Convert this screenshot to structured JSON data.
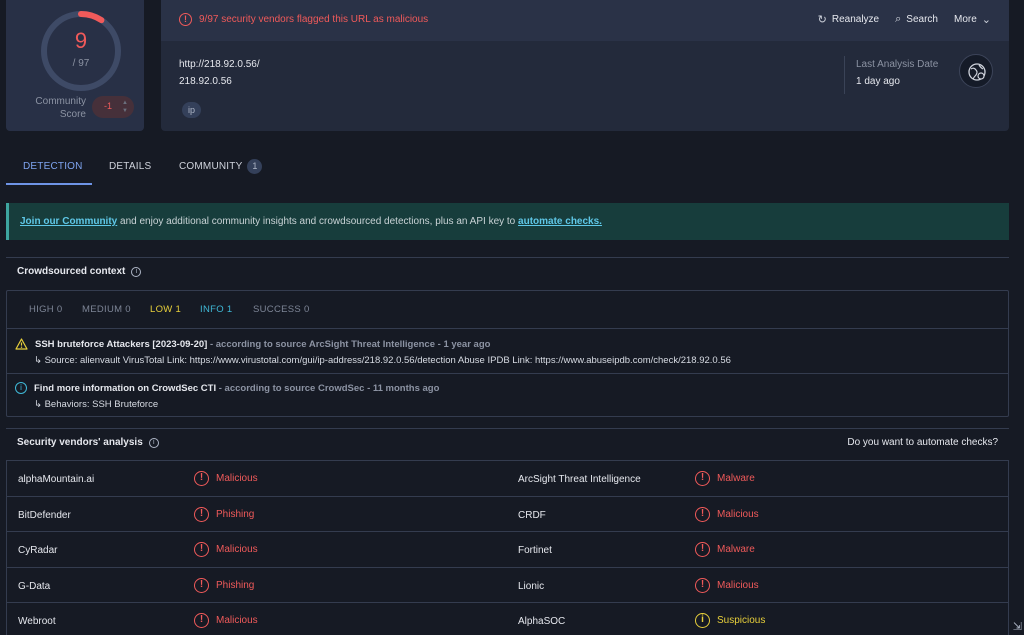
{
  "score": {
    "detections": "9",
    "total": "/ 97",
    "ratio": 0.093,
    "community_label_1": "Community",
    "community_label_2": "Score",
    "community_value": "-1"
  },
  "header": {
    "alert_text": "9/97 security vendors flagged this URL as malicious",
    "reanalyze_label": "Reanalyze",
    "search_label": "Search",
    "more_label": "More",
    "url": "http://218.92.0.56/",
    "ip": "218.92.0.56",
    "tag": "ip",
    "last_analysis_label": "Last Analysis Date",
    "last_analysis_value": "1 day ago"
  },
  "tabs": [
    {
      "label": "DETECTION",
      "active": true
    },
    {
      "label": "DETAILS",
      "active": false
    },
    {
      "label": "COMMUNITY",
      "badge": "1",
      "active": false
    }
  ],
  "banner": {
    "link1": "Join our Community",
    "middle": " and enjoy additional community insights and crowdsourced detections, plus an API key to ",
    "link2": "automate checks."
  },
  "crowdsourced": {
    "title": "Crowdsourced context",
    "severities": [
      {
        "label": "HIGH 0",
        "color": "#7d8596"
      },
      {
        "label": "MEDIUM 0",
        "color": "#7d8596"
      },
      {
        "label": "LOW 1",
        "color": "#e7cf3b"
      },
      {
        "label": "INFO 1",
        "color": "#3fb8d6"
      },
      {
        "label": "SUCCESS 0",
        "color": "#7d8596"
      }
    ],
    "items": [
      {
        "title": "SSH bruteforce Attackers [2023-09-20]",
        "source": " - according to source ArcSight Threat Intelligence - 1 year ago",
        "detail": "↳ Source: alienvault VirusTotal Link: https://www.virustotal.com/gui/ip-address/218.92.0.56/detection Abuse IPDB Link: https://www.abuseipdb.com/check/218.92.0.56"
      },
      {
        "title": "Find more information on CrowdSec CTI",
        "source": " - according to source CrowdSec - 11 months ago",
        "detail": "↳ Behaviors: SSH Bruteforce"
      }
    ]
  },
  "vendors": {
    "title": "Security vendors' analysis",
    "automate_prompt": "Do you want to automate checks?",
    "rows": [
      {
        "left_name": "alphaMountain.ai",
        "left_result": "Malicious",
        "right_name": "ArcSight Threat Intelligence",
        "right_result": "Malware"
      },
      {
        "left_name": "BitDefender",
        "left_result": "Phishing",
        "right_name": "CRDF",
        "right_result": "Malicious"
      },
      {
        "left_name": "CyRadar",
        "left_result": "Malicious",
        "right_name": "Fortinet",
        "right_result": "Malware"
      },
      {
        "left_name": "G-Data",
        "left_result": "Phishing",
        "right_name": "Lionic",
        "right_result": "Malicious"
      },
      {
        "left_name": "Webroot",
        "left_result": "Malicious",
        "right_name": "AlphaSOC",
        "right_result": "Suspicious"
      }
    ]
  },
  "colors": {
    "malicious": "#f05a5a",
    "suspicious": "#e7cf3b",
    "accent": "#6e94e6"
  }
}
